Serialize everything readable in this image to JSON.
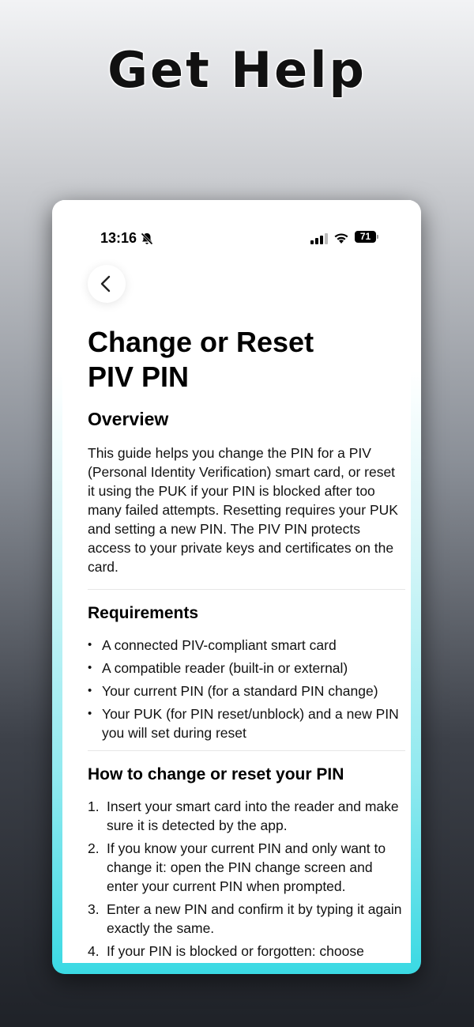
{
  "headline": "Get Help",
  "status_bar": {
    "time": "13:16",
    "battery": "71"
  },
  "page": {
    "title_line1": "Change or Reset",
    "title_line2": "PIV PIN"
  },
  "overview": {
    "heading": "Overview",
    "body": "This guide helps you change the PIN for a PIV (Personal Identity Verification) smart card, or reset it using the PUK if your PIN is blocked after too many failed attempts. Resetting requires your PUK and setting a new PIN. The PIV PIN protects access to your private keys and certificates on the card."
  },
  "requirements": {
    "heading": "Requirements",
    "items": [
      "A connected PIV-compliant smart card",
      "A compatible reader (built-in or external)",
      "Your current PIN (for a standard PIN change)",
      "Your PUK (for PIN reset/unblock) and a new PIN you will set during reset"
    ]
  },
  "howto": {
    "heading": "How to change or reset your PIN",
    "steps": [
      {
        "num": "1.",
        "text": "Insert your smart card into the reader and make sure it is detected by the app."
      },
      {
        "num": "2.",
        "text": "If you know your current PIN and only want to change it: open the PIN change screen and enter your current PIN when prompted."
      },
      {
        "num": "3.",
        "text": "Enter a new PIN and confirm it by typing it again exactly the same."
      },
      {
        "num": "4.",
        "text": "If your PIN is blocked or forgotten: choose"
      }
    ]
  },
  "icons": {
    "back": "chevron-left-icon",
    "bell": "bell-slash-icon",
    "signal": "cellular-signal-icon",
    "wifi": "wifi-icon",
    "battery": "battery-icon"
  }
}
